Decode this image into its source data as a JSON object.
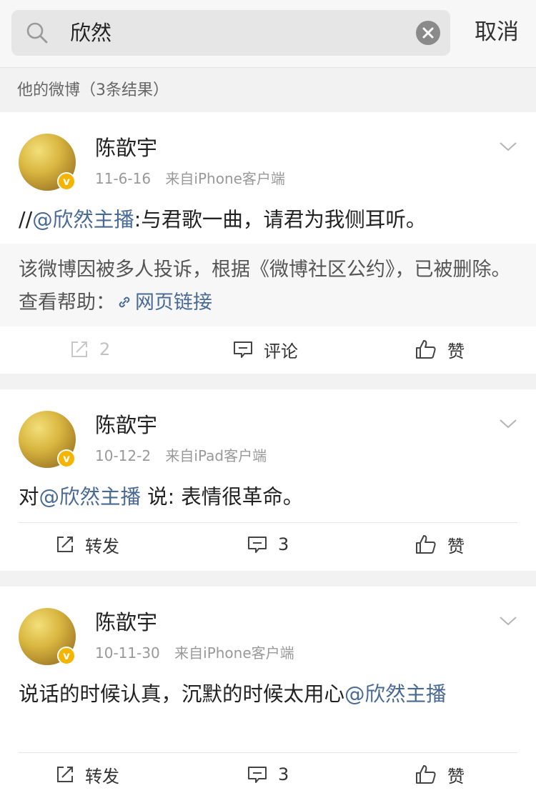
{
  "search": {
    "query": "欣然",
    "cancel_label": "取消"
  },
  "section": {
    "title": "他的微博（3条结果）"
  },
  "posts": [
    {
      "user": "陈歆宇",
      "date": "11-6-16",
      "source": "来自iPhone客户端",
      "text_prefix": "//",
      "mention": "@欣然主播",
      "text_suffix": ":与君歌一曲，请君为我侧耳听。",
      "repost_notice": "该微博因被多人投诉，根据《微博社区公约》，已被删除。查看帮助：",
      "repost_link": "网页链接",
      "actions": {
        "repost": "2",
        "comment": "评论",
        "like": "赞"
      }
    },
    {
      "user": "陈歆宇",
      "date": "10-12-2",
      "source": "来自iPad客户端",
      "text_prefix": "对",
      "mention": "@欣然主播",
      "text_suffix": " 说: 表情很革命。",
      "actions": {
        "repost": "转发",
        "comment": "3",
        "like": "赞"
      }
    },
    {
      "user": "陈歆宇",
      "date": "10-11-30",
      "source": "来自iPhone客户端",
      "text_prefix": "说话的时候认真，沉默的时候太用心",
      "mention": "@欣然主播",
      "text_suffix": "",
      "actions": {
        "repost": "转发",
        "comment": "3",
        "like": "赞"
      }
    }
  ],
  "icons": {
    "search": "search-icon",
    "clear": "clear-icon",
    "chevron": "chevron-down-icon",
    "repost": "repost-icon",
    "comment": "comment-icon",
    "like": "thumbs-up-icon",
    "link": "link-icon",
    "verified": "verified-badge-icon"
  },
  "colors": {
    "mention": "#4a6a96",
    "badge": "#f4b400"
  }
}
